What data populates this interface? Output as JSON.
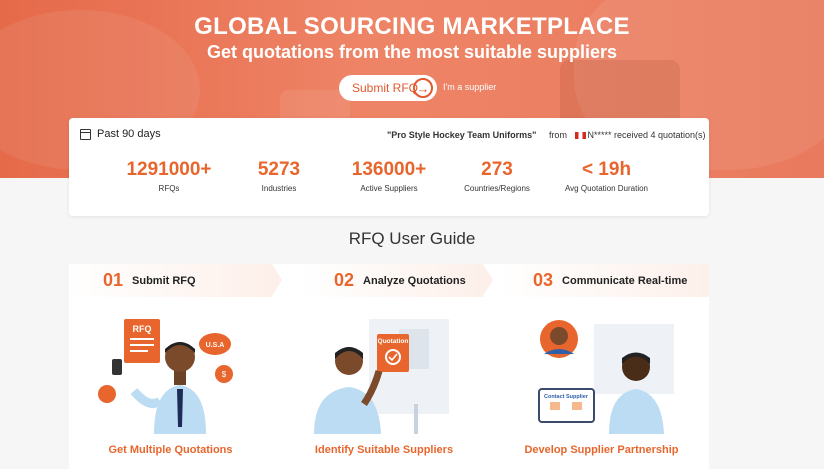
{
  "hero": {
    "title": "GLOBAL SOURCING MARKETPLACE",
    "subtitle": "Get quotations from the most suitable suppliers",
    "submit_label": "Submit RFQ",
    "supplier_label": "I'm a supplier"
  },
  "stats": {
    "period": "Past 90 days",
    "ticker_product": "\"Pro Style Hockey Team Uniforms\"",
    "ticker_from": "from",
    "ticker_buyer": "N*****",
    "ticker_rest": "received 4 quotation(s)",
    "items": [
      {
        "value": "1291000+",
        "label": "RFQs"
      },
      {
        "value": "5273",
        "label": "Industries"
      },
      {
        "value": "136000+",
        "label": "Active Suppliers"
      },
      {
        "value": "273",
        "label": "Countries/Regions"
      },
      {
        "value": "< 19h",
        "label": "Avg Quotation Duration"
      }
    ]
  },
  "guide": {
    "title": "RFQ User Guide",
    "steps": [
      {
        "num": "01",
        "title": "Submit RFQ",
        "caption": "Get Multiple Quotations"
      },
      {
        "num": "02",
        "title": "Analyze Quotations",
        "caption": "Identify Suitable Suppliers"
      },
      {
        "num": "03",
        "title": "Communicate Real-time",
        "caption": "Develop Supplier Partnership"
      }
    ],
    "illus1": {
      "rfq": "RFQ",
      "usa": "U.S.A"
    },
    "illus2": {
      "quotation": "Quotation"
    },
    "illus3": {
      "contact": "Contact Supplier"
    }
  },
  "colors": {
    "accent": "#e8662d",
    "hero": "#e97a5d"
  }
}
